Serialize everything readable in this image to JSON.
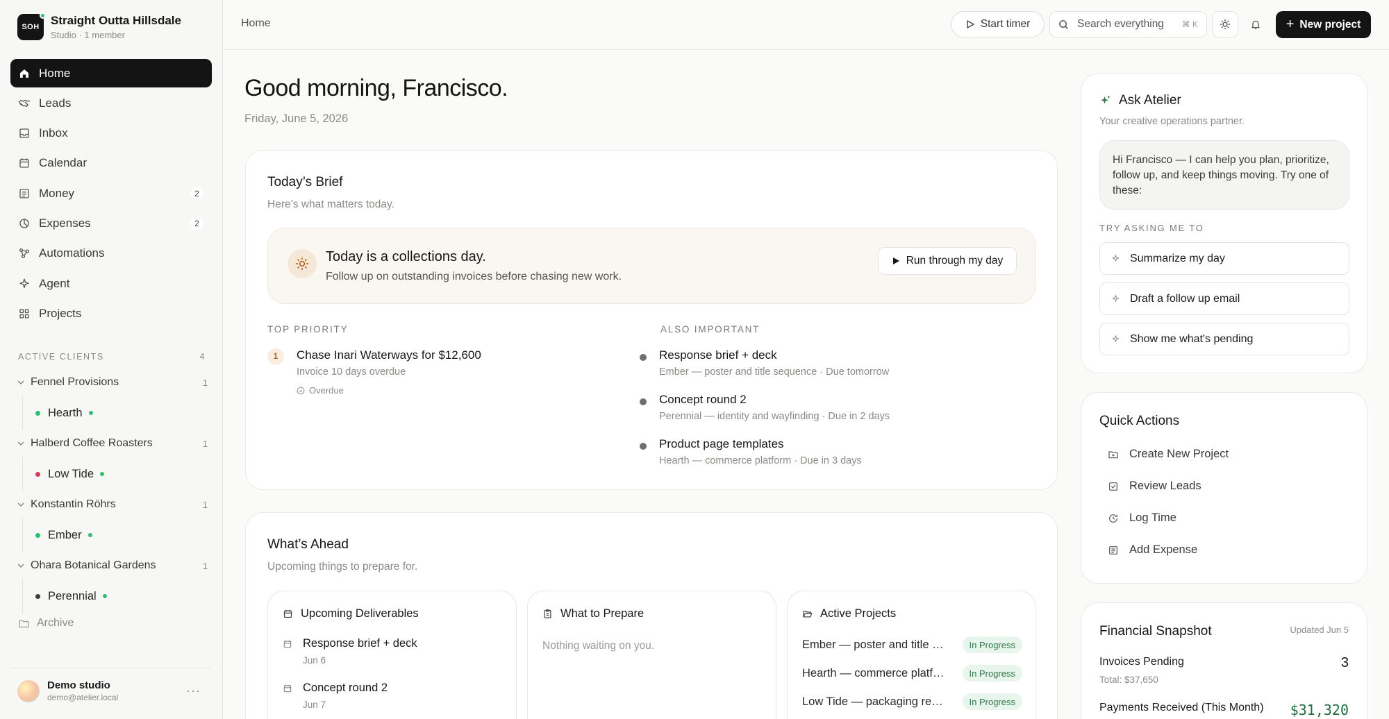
{
  "colors": {
    "accent": "#141414",
    "success": "#2fbf71",
    "danger": "#d83b5a",
    "background": "#fafaf8"
  },
  "workspace": {
    "initials": "SOH",
    "name": "Straight Outta Hillsdale",
    "subtitle": "Studio · 1 member"
  },
  "nav": [
    {
      "label": "Home",
      "icon": "home-icon",
      "active": true
    },
    {
      "label": "Leads",
      "icon": "handshake-icon"
    },
    {
      "label": "Inbox",
      "icon": "inbox-icon"
    },
    {
      "label": "Calendar",
      "icon": "calendar-icon"
    },
    {
      "label": "Money",
      "icon": "receipt-icon",
      "badge": "2"
    },
    {
      "label": "Expenses",
      "icon": "pie-icon",
      "badge": "2"
    },
    {
      "label": "Automations",
      "icon": "workflow-icon"
    },
    {
      "label": "Agent",
      "icon": "sparkle-icon"
    },
    {
      "label": "Projects",
      "icon": "grid-icon"
    }
  ],
  "active_clients": {
    "label": "ACTIVE CLIENTS",
    "count": "4",
    "clients": [
      {
        "name": "Fennel Provisions",
        "count": "1",
        "project": "Hearth",
        "dot": "#2fbf71"
      },
      {
        "name": "Halberd Coffee Roasters",
        "count": "1",
        "project": "Low Tide",
        "dot": "#d83b5a"
      },
      {
        "name": "Konstantin Röhrs",
        "count": "1",
        "project": "Ember",
        "dot": "#2fbf71"
      },
      {
        "name": "Ohara Botanical Gardens",
        "count": "1",
        "project": "Perennial",
        "dot": "#3a3a38"
      }
    ]
  },
  "archive_label": "Archive",
  "user": {
    "name": "Demo studio",
    "email": "demo@atelier.local",
    "more": "···"
  },
  "topbar": {
    "breadcrumb": "Home",
    "timer_label": "Start timer",
    "search_placeholder": "Search everything",
    "search_shortcut": "⌘ K",
    "new_label": "New project"
  },
  "greeting": "Good morning, Francisco.",
  "date": "Friday, June 5, 2026",
  "brief": {
    "title": "Today’s Brief",
    "subtitle": "Here’s what matters today.",
    "callout_title": "Today is a collections day.",
    "callout_sub": "Follow up on outstanding invoices before chasing new work.",
    "run_label": "Run through my day",
    "top_priority_label": "TOP PRIORITY",
    "priority": {
      "number": "1",
      "title": "Chase Inari Waterways for $12,600",
      "subtitle": "Invoice 10 days overdue",
      "tag": "Overdue"
    },
    "also_label": "ALSO IMPORTANT",
    "also": [
      {
        "title": "Response brief + deck",
        "subtitle": "Ember — poster and title sequence · Due tomorrow"
      },
      {
        "title": "Concept round 2",
        "subtitle": "Perennial — identity and wayfinding · Due in 2 days"
      },
      {
        "title": "Product page templates",
        "subtitle": "Hearth — commerce platform · Due in 3 days"
      }
    ]
  },
  "ahead": {
    "title": "What’s Ahead",
    "subtitle": "Upcoming things to prepare for.",
    "deliverables": {
      "title": "Upcoming Deliverables",
      "items": [
        {
          "title": "Response brief + deck",
          "date": "Jun 6"
        },
        {
          "title": "Concept round 2",
          "date": "Jun 7"
        }
      ]
    },
    "prepare": {
      "title": "What to Prepare",
      "empty": "Nothing waiting on you."
    },
    "projects": {
      "title": "Active Projects",
      "items": [
        {
          "name": "Ember — poster and title sequence",
          "status": "In Progress"
        },
        {
          "name": "Hearth — commerce platform",
          "status": "In Progress"
        },
        {
          "name": "Low Tide — packaging redesign",
          "status": "In Progress"
        }
      ]
    }
  },
  "ask": {
    "title": "Ask Atelier",
    "subtitle": "Your creative operations partner.",
    "message": "Hi Francisco — I can help you plan, prioritize, follow up, and keep things moving. Try one of these:",
    "try_label": "TRY ASKING ME TO",
    "suggestions": [
      "Summarize my day",
      "Draft a follow up email",
      "Show me what's pending"
    ]
  },
  "quick_actions": {
    "title": "Quick Actions",
    "items": [
      {
        "label": "Create New Project",
        "icon": "folder-plus-icon"
      },
      {
        "label": "Review Leads",
        "icon": "checkbox-icon"
      },
      {
        "label": "Log Time",
        "icon": "clock-icon"
      },
      {
        "label": "Add Expense",
        "icon": "receipt-icon"
      }
    ]
  },
  "financial": {
    "title": "Financial Snapshot",
    "updated": "Updated Jun 5",
    "invoices_label": "Invoices Pending",
    "invoices_value": "3",
    "invoices_total": "Total: $37,650",
    "payments_label": "Payments Received (This Month)",
    "payments_value": "$31,320"
  }
}
